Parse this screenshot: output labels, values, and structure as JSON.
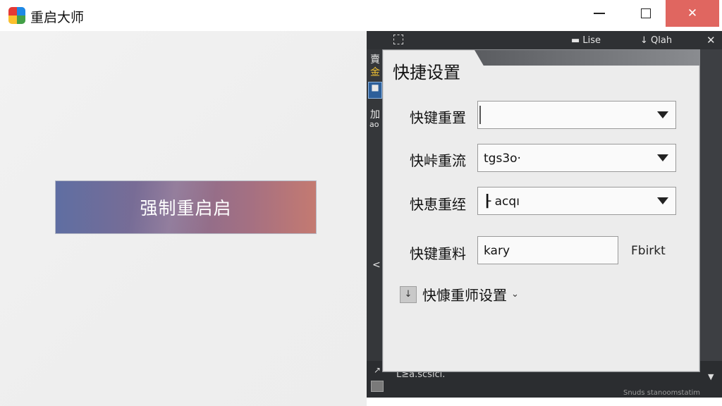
{
  "window": {
    "title": "重启大师",
    "minimize_icon": "minimize-icon",
    "maximize_icon": "maximize-icon",
    "close_glyph": "✕",
    "close_color": "#e06660"
  },
  "main": {
    "force_restart_label": "强制重启启",
    "button_gradient": [
      "#5f6ea2",
      "#c47a71"
    ]
  },
  "background_panel": {
    "top_list": "Lise",
    "top_qlah": "Qlah",
    "top_close": "✕",
    "side_1": "賣",
    "side_2": "金",
    "side_4": "加",
    "side_5": "ao",
    "side_chevron": "<",
    "bottom_text": "L≥a.scslcl.",
    "bottom_arrow": "↗",
    "bottom_faint": "Snuds stanoomstatim",
    "bottom_scroll": "▼"
  },
  "dialog": {
    "title": "快捷设置",
    "rows": [
      {
        "label": "快键重置",
        "value": ""
      },
      {
        "label": "快峠重流",
        "value": "tgs3o·"
      },
      {
        "label": "快恵重绖",
        "value": "acqı"
      },
      {
        "label": "快键重料",
        "value": "kary",
        "note": "Fbirkt"
      }
    ],
    "advanced_label": "快慷重师设置",
    "advanced_icon_glyph": "↓",
    "advanced_chevron": "⌄"
  }
}
